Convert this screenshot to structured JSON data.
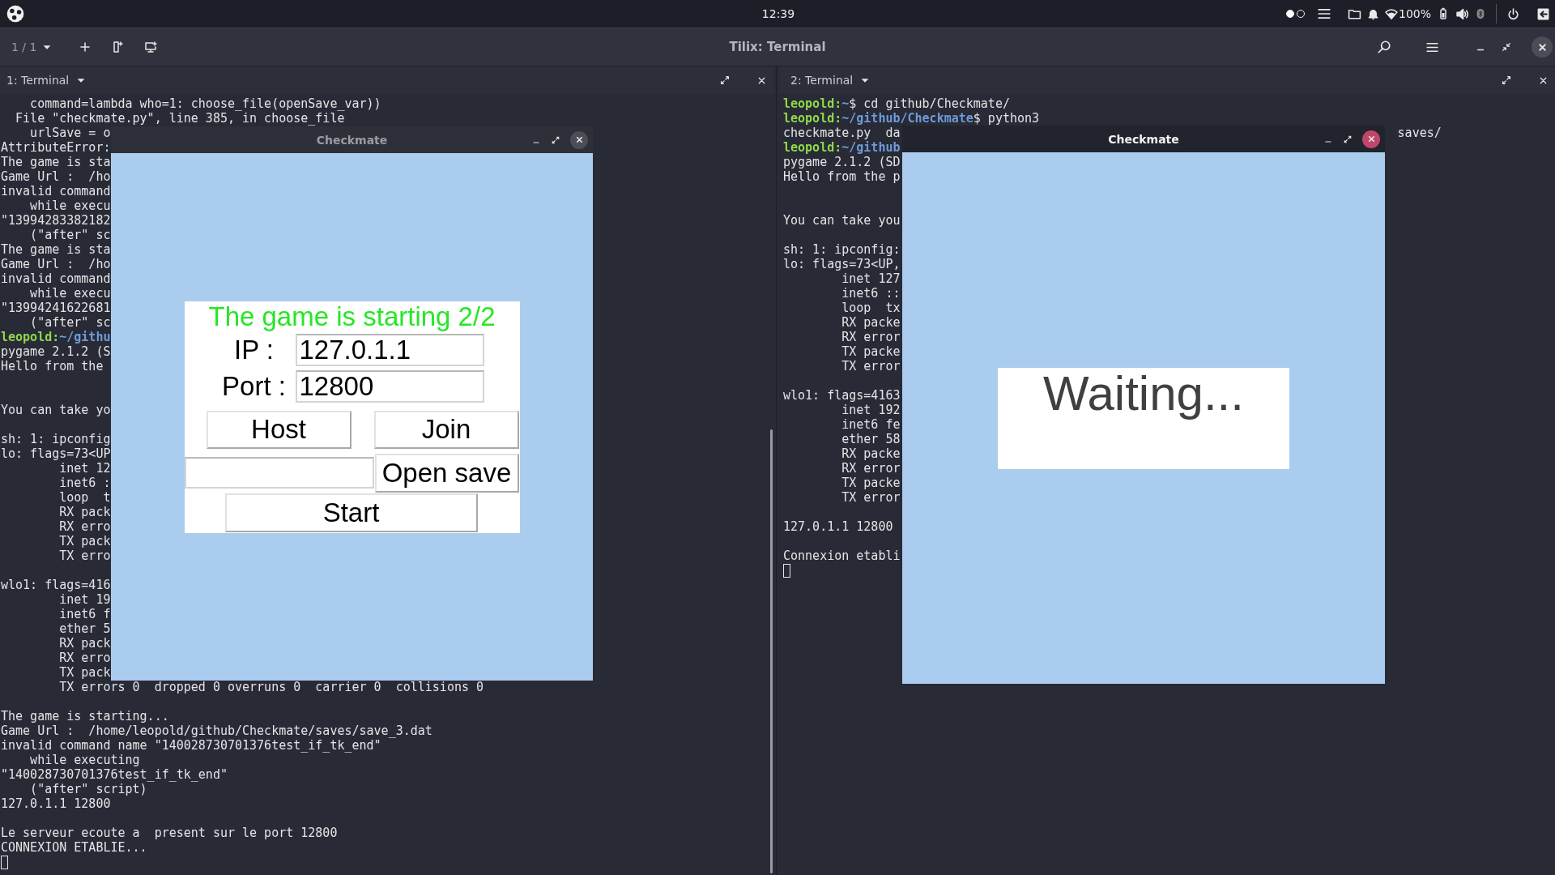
{
  "top_bar": {
    "clock": "12:39",
    "workspaces": [
      {
        "selected": true
      },
      {
        "selected": false
      }
    ],
    "battery": "100%"
  },
  "header": {
    "session": "1 / 1",
    "title": "Tilix: Terminal"
  },
  "panes": [
    {
      "title": "1: Terminal",
      "cursor": true,
      "lines": [
        {
          "text": "    command=lambda who=1: choose_file(openSave_var))"
        },
        {
          "text": "  File \"checkmate.py\", line 385, in choose_file"
        },
        {
          "text": "    urlSave = o"
        },
        {
          "text": "AttributeError:"
        },
        {
          "text": "The game is sta"
        },
        {
          "text": "Game Url :  /ho"
        },
        {
          "text": "invalid command"
        },
        {
          "text": "    while execu"
        },
        {
          "text": "\"13994283382182"
        },
        {
          "text": "    (\"after\" sc"
        },
        {
          "text": "The game is sta"
        },
        {
          "text": "Game Url :  /ho"
        },
        {
          "text": "invalid command"
        },
        {
          "text": "    while execu"
        },
        {
          "text": "\"13994241622681"
        },
        {
          "text": "    (\"after\" sc"
        },
        {
          "kind": "prompt",
          "user": "leopold:",
          "path": "~/githu"
        },
        {
          "text": "pygame 2.1.2 (S"
        },
        {
          "text": "Hello from the"
        },
        {
          "kind": "blank"
        },
        {
          "kind": "blank"
        },
        {
          "text": "You can take yo"
        },
        {
          "kind": "blank"
        },
        {
          "text": "sh: 1: ipconfig"
        },
        {
          "text": "lo: flags=73<UP"
        },
        {
          "text": "        inet 12"
        },
        {
          "text": "        inet6 :"
        },
        {
          "text": "        loop  t"
        },
        {
          "text": "        RX pack"
        },
        {
          "text": "        RX erro"
        },
        {
          "text": "        TX pack"
        },
        {
          "text": "        TX erro"
        },
        {
          "kind": "blank"
        },
        {
          "text": "wlo1: flags=416"
        },
        {
          "text": "        inet 19"
        },
        {
          "text": "        inet6 f"
        },
        {
          "text": "        ether 5"
        },
        {
          "text": "        RX pack"
        },
        {
          "text": "        RX erro"
        },
        {
          "text": "        TX pack"
        },
        {
          "text": "        TX errors 0  dropped 0 overruns 0  carrier 0  collisions 0"
        },
        {
          "kind": "blank"
        },
        {
          "text": "The game is starting..."
        },
        {
          "text": "Game Url :  /home/leopold/github/Checkmate/saves/save_3.dat"
        },
        {
          "text": "invalid command name \"140028730701376test_if_tk_end\""
        },
        {
          "text": "    while executing"
        },
        {
          "text": "\"140028730701376test_if_tk_end\""
        },
        {
          "text": "    (\"after\" script)"
        },
        {
          "text": "127.0.1.1 12800"
        },
        {
          "kind": "blank"
        },
        {
          "text": "Le serveur ecoute a  present sur le port 12800"
        },
        {
          "text": "CONNEXION ETABLIE..."
        }
      ],
      "window": {
        "title": "Checkmate",
        "active": false,
        "kind": "form",
        "heading": "The game is starting 2/2",
        "fields": [
          {
            "label": "IP :",
            "value": "127.0.1.1"
          },
          {
            "label": "Port :",
            "value": "12800"
          }
        ],
        "buttons": [
          "Host",
          "Join"
        ],
        "save_button": "Open save",
        "start_button": "Start"
      }
    },
    {
      "title": "2: Terminal",
      "cursor": true,
      "lines": [
        {
          "kind": "prompt",
          "user": "leopold:",
          "path": "~",
          "command": "$ cd github/Checkmate/"
        },
        {
          "kind": "prompt",
          "user": "leopold:",
          "path": "~/github/Checkmate",
          "command": "$ python3"
        },
        {
          "text": "checkmate.py  da",
          "after": "saves/"
        },
        {
          "kind": "prompt",
          "user": "leopold:",
          "path": "~/github"
        },
        {
          "text": "pygame 2.1.2 (SD"
        },
        {
          "text": "Hello from the p"
        },
        {
          "kind": "blank"
        },
        {
          "kind": "blank"
        },
        {
          "text": "You can take you"
        },
        {
          "kind": "blank"
        },
        {
          "text": "sh: 1: ipconfig:"
        },
        {
          "text": "lo: flags=73<UP,"
        },
        {
          "text": "        inet 127"
        },
        {
          "text": "        inet6 ::"
        },
        {
          "text": "        loop  tx"
        },
        {
          "text": "        RX packe"
        },
        {
          "text": "        RX error"
        },
        {
          "text": "        TX packe"
        },
        {
          "text": "        TX error"
        },
        {
          "kind": "blank"
        },
        {
          "text": "wlo1: flags=4163"
        },
        {
          "text": "        inet 192"
        },
        {
          "text": "        inet6 fe"
        },
        {
          "text": "        ether 58"
        },
        {
          "text": "        RX packe"
        },
        {
          "text": "        RX error"
        },
        {
          "text": "        TX packe"
        },
        {
          "text": "        TX error"
        },
        {
          "kind": "blank"
        },
        {
          "text": "127.0.1.1 12800"
        },
        {
          "kind": "blank"
        },
        {
          "text": "Connexion etabli"
        }
      ],
      "window": {
        "title": "Checkmate",
        "active": true,
        "kind": "waiting",
        "message": "Waiting..."
      }
    }
  ]
}
